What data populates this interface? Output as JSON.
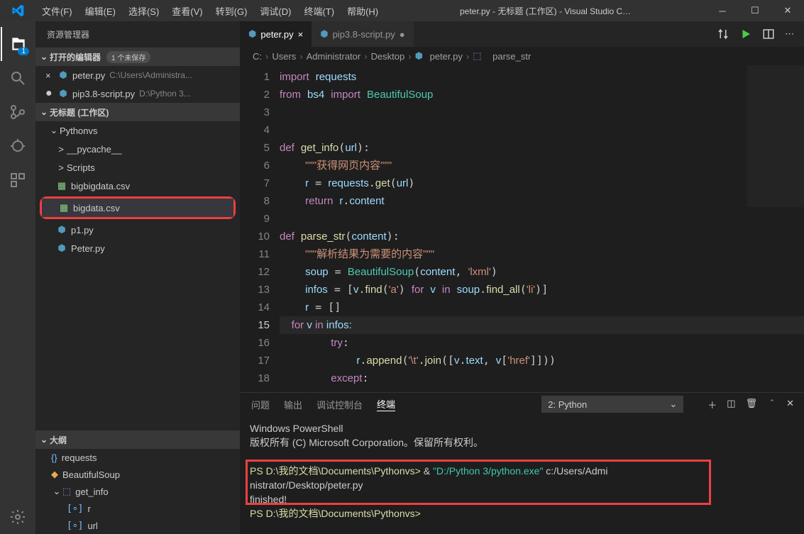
{
  "menus": [
    "文件(F)",
    "编辑(E)",
    "选择(S)",
    "查看(V)",
    "转到(G)",
    "调试(D)",
    "终端(T)",
    "帮助(H)"
  ],
  "title": "peter.py - 无标题 (工作区) - Visual Studio C…",
  "sidebar": {
    "title": "资源管理器",
    "open_editors": "打开的编辑器",
    "unsaved_badge": "1 个未保存",
    "workspace": "无标题 (工作区)",
    "editors": [
      {
        "icon": "×",
        "name": "peter.py",
        "path": "C:\\Users\\Administra..."
      },
      {
        "icon": "●",
        "name": "pip3.8-script.py",
        "path": "D:\\Python 3..."
      }
    ],
    "tree": {
      "root": "Pythonvs",
      "children": [
        {
          "type": "dir",
          "chev": ">",
          "name": "__pycache__"
        },
        {
          "type": "dir",
          "chev": ">",
          "name": "Scripts"
        },
        {
          "type": "csv",
          "name": "bigbigdata.csv"
        },
        {
          "type": "csv",
          "name": "bigdata.csv",
          "selected": true,
          "boxed": true
        },
        {
          "type": "py",
          "name": "p1.py"
        },
        {
          "type": "py",
          "name": "Peter.py"
        }
      ]
    },
    "outline_title": "大纲",
    "outline": [
      {
        "icon": "brace",
        "label": "requests"
      },
      {
        "icon": "cls",
        "label": "BeautifulSoup"
      },
      {
        "icon": "cube",
        "label": "get_info",
        "expand": true
      },
      {
        "icon": "var",
        "label": "r",
        "indent": true
      },
      {
        "icon": "var",
        "label": "url",
        "indent": true
      }
    ]
  },
  "tabs": [
    {
      "name": "peter.py",
      "active": true,
      "close": "×"
    },
    {
      "name": "pip3.8-script.py",
      "active": false,
      "close": "●"
    }
  ],
  "breadcrumb": [
    "C:",
    "Users",
    "Administrator",
    "Desktop",
    "peter.py",
    "parse_str"
  ],
  "code_lines": [
    "1",
    "2",
    "3",
    "4",
    "5",
    "6",
    "7",
    "8",
    "9",
    "10",
    "11",
    "12",
    "13",
    "14",
    "15",
    "16",
    "17",
    "18"
  ],
  "code": {
    "l1": "import requests",
    "l2": "from bs4 import BeautifulSoup",
    "l5": "def get_info(url):",
    "l6": "    \"\"\"获得网页内容\"\"\"",
    "l7": "    r = requests.get(url)",
    "l8": "    return r.content",
    "l10": "def parse_str(content):",
    "l11": "    \"\"\"解析结果为需要的内容\"\"\"",
    "l12": "    soup = BeautifulSoup(content, 'lxml')",
    "l13": "    infos = [v.find('a') for v in soup.find_all('li')]",
    "l14": "    r = []",
    "l15": "    for v in infos:",
    "l16": "        try:",
    "l17": "            r.append('\\t'.join([v.text, v['href']]))",
    "l18": "        except:"
  },
  "panel": {
    "tabs": [
      "问题",
      "输出",
      "调试控制台",
      "终端"
    ],
    "select": "2: Python",
    "term": {
      "l1": "Windows PowerShell",
      "l2": "版权所有 (C) Microsoft Corporation。保留所有权利。",
      "l3a": "PS D:\\我的文档\\Documents\\Pythonvs> ",
      "l3amp": "& ",
      "l3b": "\"D:/Python 3/python.exe\"",
      "l3c": " c:/Users/Admi",
      "l4": "nistrator/Desktop/peter.py",
      "l5": "finished!",
      "l6": "PS D:\\我的文档\\Documents\\Pythonvs>"
    }
  },
  "activity_badge": "1"
}
